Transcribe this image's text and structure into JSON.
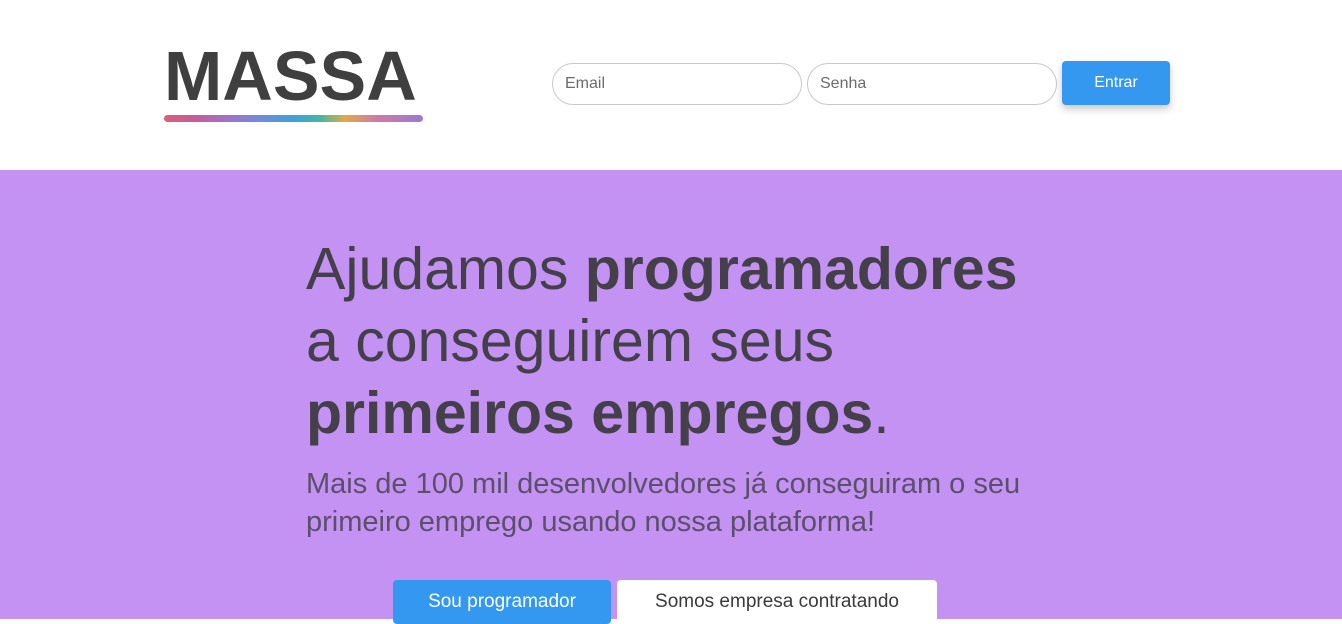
{
  "header": {
    "logo_text": "MASSA",
    "login": {
      "email_placeholder": "Email",
      "password_placeholder": "Senha",
      "submit_label": "Entrar"
    }
  },
  "hero": {
    "headline": {
      "part1": "Ajudamos ",
      "part2": "programadores",
      "part3": "a conseguirem seus",
      "part4": "primeiros empregos",
      "part5": "."
    },
    "subheadline": "Mais de 100 mil desenvolvedores já conseguiram o seu primeiro emprego usando nossa plataforma!",
    "buttons": {
      "developer": "Sou programador",
      "company": "Somos empresa contratando"
    }
  },
  "colors": {
    "hero_background": "#c392f2",
    "accent_blue": "#3498f0",
    "text_dark": "#44404a"
  }
}
